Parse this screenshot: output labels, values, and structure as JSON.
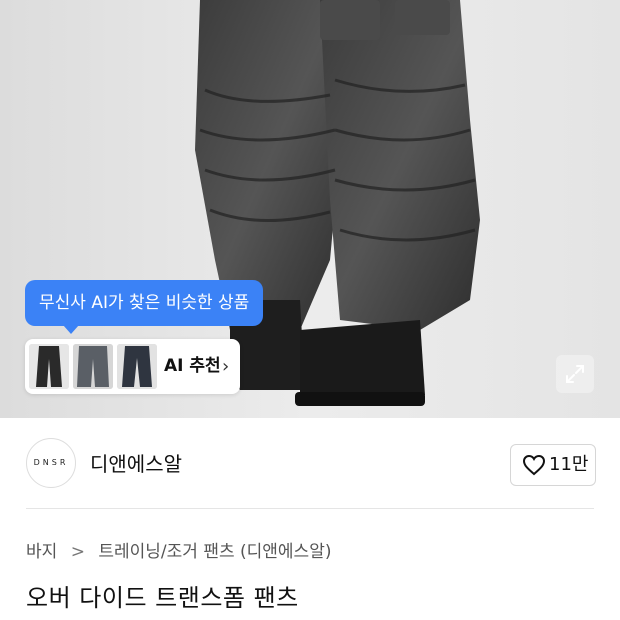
{
  "ai_similar": {
    "bubble_text": "무신사 AI가 찾은 비슷한 상품",
    "button_label": "AI 추천",
    "chevron": "›"
  },
  "icons": {
    "expand": "expand-icon",
    "heart": "heart-icon",
    "chevron": "chevron-right-icon"
  },
  "brand": {
    "logo_text": "DNSR",
    "name": "디앤에스알",
    "likes": "11만"
  },
  "breadcrumb": {
    "category": "바지",
    "separator": ">",
    "subcategory": "트레이닝/조거 팬츠 (디앤에스알)"
  },
  "product": {
    "title": "오버 다이드 트랜스폼 팬츠"
  },
  "colors": {
    "accent": "#3b82f6",
    "background": "#ffffff",
    "text": "#111111"
  }
}
